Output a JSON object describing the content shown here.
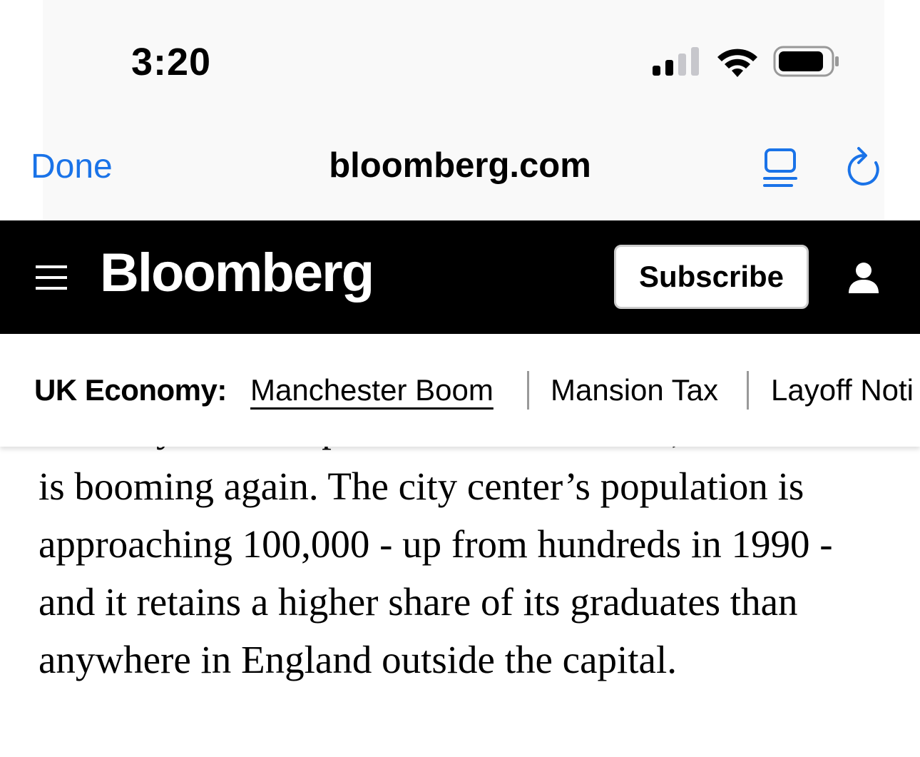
{
  "status_bar": {
    "time": "3:20",
    "signal_icon": "cellular-signal-icon",
    "wifi_icon": "wifi-icon",
    "battery_icon": "battery-icon"
  },
  "browser": {
    "done_label": "Done",
    "url": "bloomberg.com",
    "reader_icon": "reader-view-icon",
    "reload_icon": "reload-icon",
    "accent_color": "#1a73e8"
  },
  "site_header": {
    "menu_icon": "hamburger-menu-icon",
    "logo": "Bloomberg",
    "subscribe_label": "Subscribe",
    "account_icon": "account-icon"
  },
  "topic_nav": {
    "label": "UK Economy:",
    "links": [
      {
        "label": "Manchester Boom"
      },
      {
        "label": "Mansion Tax"
      },
      {
        "label": "Layoff Noti"
      }
    ]
  },
  "article": {
    "paragraph": "was a byword for post-industrial decline, Manchester is booming again. The city center’s population is approaching 100,000 - up from hundreds in 1990 - and it retains a higher share of its graduates than anywhere in England outside the capital."
  }
}
